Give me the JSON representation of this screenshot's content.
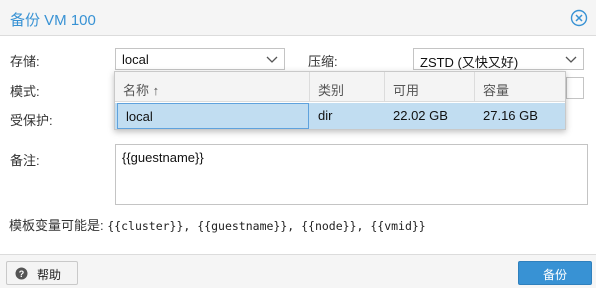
{
  "dialog": {
    "title": "备份 VM 100"
  },
  "form": {
    "storage_label": "存储:",
    "storage_value": "local",
    "compression_label": "压缩:",
    "compression_value": "ZSTD (又快又好)",
    "mode_label": "模式:",
    "protected_label": "受保护:",
    "notes_label": "备注:",
    "notes_value": "{{guestname}}",
    "vars_label": "模板变量可能是:",
    "vars_value": "{{cluster}}, {{guestname}}, {{node}}, {{vmid}}"
  },
  "storage_dropdown": {
    "columns": [
      "名称 ↑",
      "类别",
      "可用",
      "容量"
    ],
    "rows": [
      {
        "name": "local",
        "type": "dir",
        "avail": "22.02 GB",
        "capacity": "27.16 GB",
        "selected": true
      }
    ]
  },
  "footer": {
    "help_label": "帮助",
    "backup_label": "备份"
  },
  "colors": {
    "accent": "#3892d4",
    "selection": "#c1ddf1"
  },
  "icons": {
    "close": "close-circle-icon",
    "help": "question-circle-icon",
    "chevron": "chevron-down-icon",
    "sort": "sort-ascending-icon"
  }
}
